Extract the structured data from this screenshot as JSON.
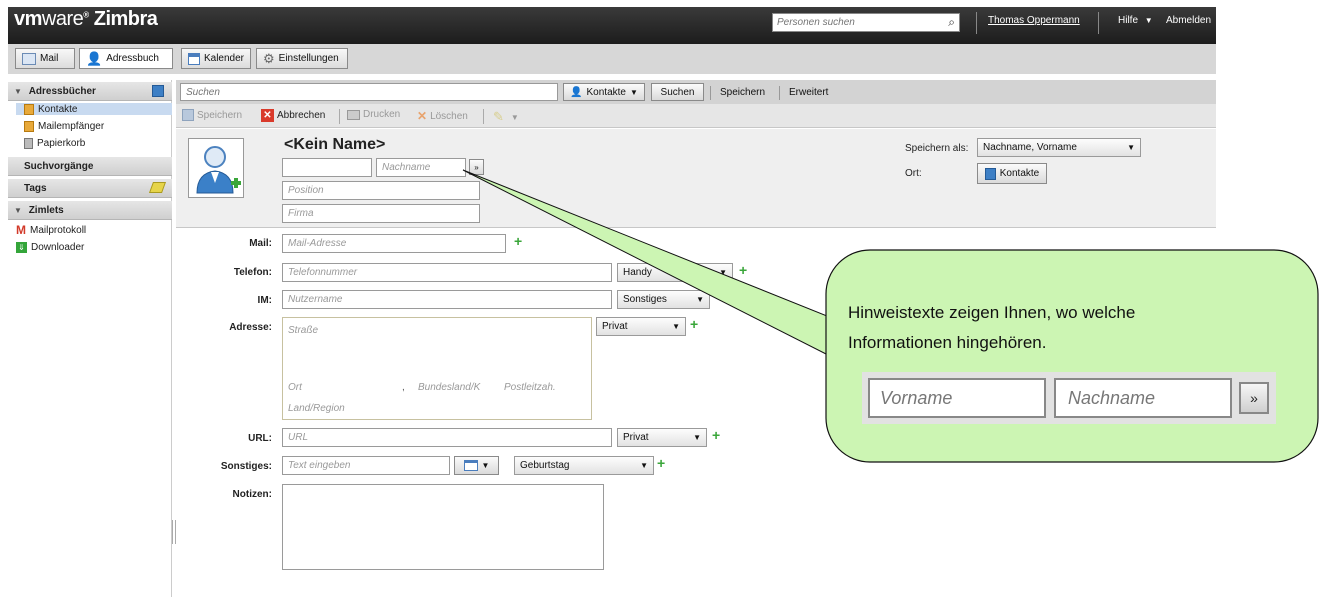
{
  "app": {
    "logo_vm": "vm",
    "logo_ware": "ware",
    "logo_product": " Zimbra",
    "people_search_placeholder": "Personen suchen",
    "username": "Thomas Oppermann",
    "help": "Hilfe",
    "logout": "Abmelden"
  },
  "tabs": [
    {
      "label": "Mail",
      "icon": "mail-icon"
    },
    {
      "label": "Adressbuch",
      "icon": "contacts-icon"
    },
    {
      "label": "Kalender",
      "icon": "calendar-icon"
    },
    {
      "label": "Einstellungen",
      "icon": "gear-icon"
    }
  ],
  "sidebar": {
    "addressbooks_header": "Adressbücher",
    "items": [
      "Kontakte",
      "Mailempfänger",
      "Papierkorb"
    ],
    "searches_header": "Suchvorgänge",
    "tags_header": "Tags",
    "zimlets_header": "Zimlets",
    "zimlets": [
      "Mailprotokoll",
      "Downloader"
    ]
  },
  "search": {
    "placeholder": "Suchen",
    "scope": "Kontakte",
    "search_btn": "Suchen",
    "save_btn": "Speichern",
    "advanced": "Erweitert"
  },
  "toolbar": {
    "save": "Speichern",
    "cancel": "Abbrechen",
    "print": "Drucken",
    "delete": "Löschen"
  },
  "contact": {
    "name_title": "<Kein Name>",
    "firstname_value": "",
    "lastname_placeholder": "Nachname",
    "position_placeholder": "Position",
    "company_placeholder": "Firma",
    "save_as_label": "Speichern als:",
    "save_as_value": "Nachname, Vorname",
    "location_label": "Ort:",
    "location_value": "Kontakte"
  },
  "form": {
    "mail_label": "Mail:",
    "mail_placeholder": "Mail-Adresse",
    "phone_label": "Telefon:",
    "phone_placeholder": "Telefonnummer",
    "phone_type": "Handy",
    "im_label": "IM:",
    "im_placeholder": "Nutzername",
    "im_type": "Sonstiges",
    "address_label": "Adresse:",
    "address_street": "Straße",
    "address_city": "Ort",
    "address_comma": ",",
    "address_state": "Bundesland/K",
    "address_zip": "Postleitzah.",
    "address_country": "Land/Region",
    "address_type": "Privat",
    "url_label": "URL:",
    "url_placeholder": "URL",
    "url_type": "Privat",
    "other_label": "Sonstiges:",
    "other_placeholder": "Text eingeben",
    "other_type": "Geburtstag",
    "notes_label": "Notizen:"
  },
  "callout": {
    "line1": "Hinweistexte zeigen Ihnen, wo welche",
    "line2": "Informationen hingehören.",
    "demo_firstname": "Vorname",
    "demo_lastname": "Nachname",
    "demo_button": "»",
    "fill_color": "#ccf5b3"
  }
}
